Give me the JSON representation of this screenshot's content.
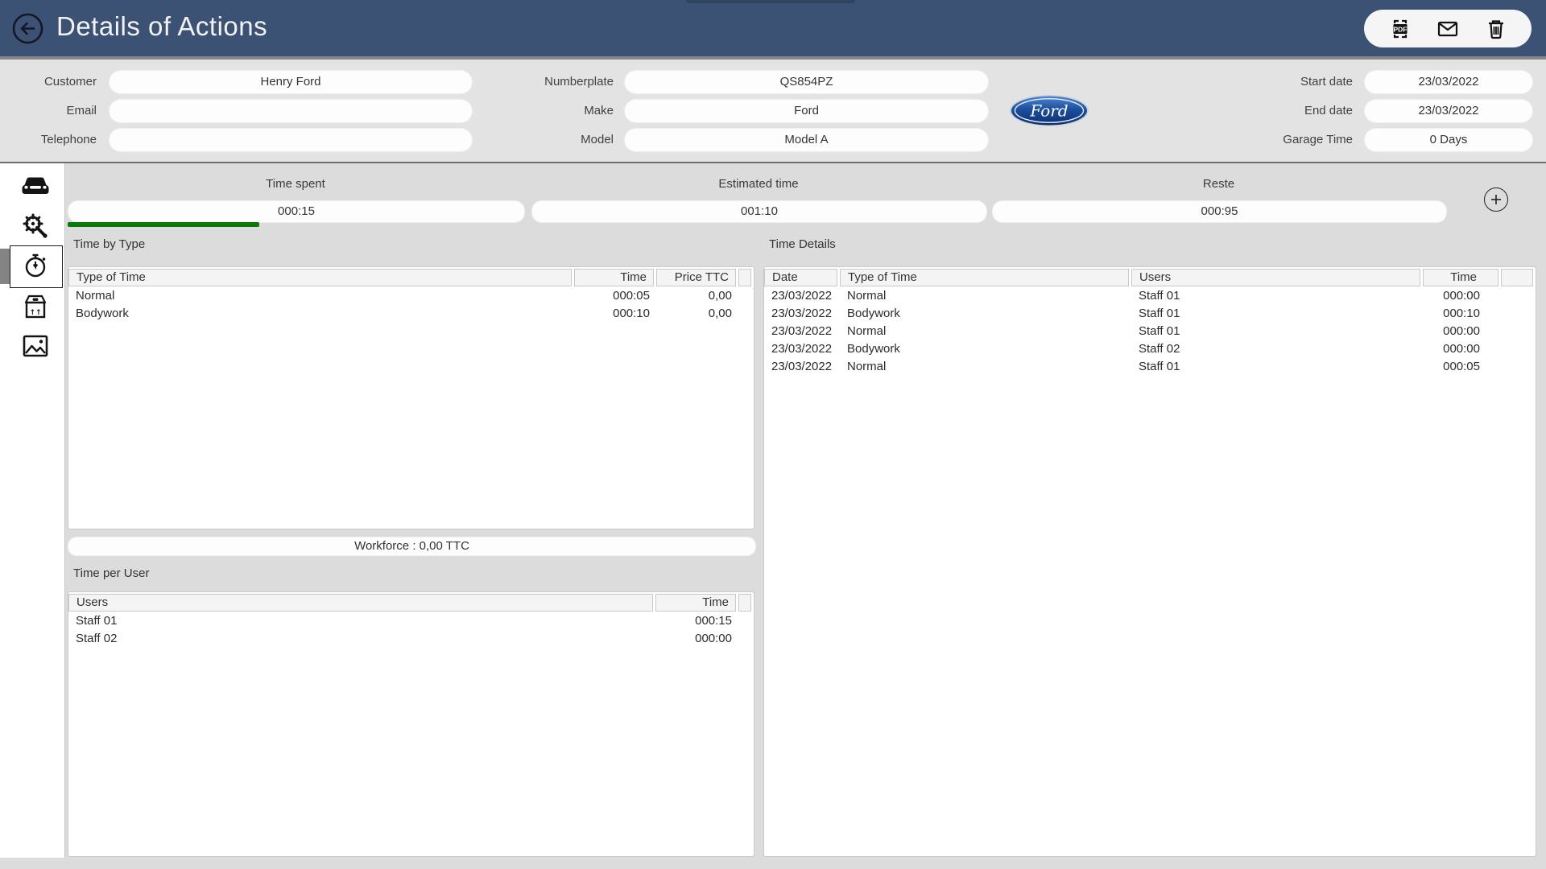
{
  "header": {
    "title": "Details of Actions",
    "toolbar_icons": [
      "pdf",
      "email",
      "delete"
    ]
  },
  "colors": {
    "header_bg": "#3b5275",
    "progress_green": "#0a7a0a",
    "ford_blue": "#1b4fa0"
  },
  "form": {
    "fields": [
      {
        "label": "Customer",
        "value": "Henry Ford"
      },
      {
        "label": "Email",
        "value": ""
      },
      {
        "label": "Telephone",
        "value": ""
      },
      {
        "label": "Numberplate",
        "value": "QS854PZ"
      },
      {
        "label": "Make",
        "value": "Ford"
      },
      {
        "label": "Model",
        "value": "Model A"
      },
      {
        "label": "Start date",
        "value": "23/03/2022"
      },
      {
        "label": "End date",
        "value": "23/03/2022"
      },
      {
        "label": "Garage Time",
        "value": "0 Days"
      }
    ],
    "brand": "Ford"
  },
  "sidebar": {
    "items": [
      {
        "icon": "car-icon",
        "selected": false
      },
      {
        "icon": "service-icon",
        "selected": false
      },
      {
        "icon": "stopwatch-icon",
        "selected": true
      },
      {
        "icon": "parts-box-icon",
        "selected": false
      },
      {
        "icon": "photos-icon",
        "selected": false
      }
    ]
  },
  "gauges": [
    {
      "label": "Time spent",
      "value": "000:15",
      "progress_pct": 42
    },
    {
      "label": "Estimated time",
      "value": "001:10"
    },
    {
      "label": "Reste",
      "value": "000:95"
    }
  ],
  "time_by_type": {
    "title": "Time by Type",
    "columns": [
      "Type of Time",
      "Time",
      "Price TTC"
    ],
    "rows": [
      [
        "Normal",
        "000:05",
        "0,00"
      ],
      [
        "Bodywork",
        "000:10",
        "0,00"
      ]
    ]
  },
  "workforce_summary": "Workforce : 0,00 TTC",
  "time_per_user": {
    "title": "Time per User",
    "columns": [
      "Users",
      "Time"
    ],
    "rows": [
      [
        "Staff 01",
        "000:15"
      ],
      [
        "Staff 02",
        "000:00"
      ]
    ]
  },
  "time_details": {
    "title": "Time Details",
    "columns": [
      "Date",
      "Type of Time",
      "Users",
      "Time"
    ],
    "rows": [
      [
        "23/03/2022",
        "Normal",
        "Staff 01",
        "000:00"
      ],
      [
        "23/03/2022",
        "Bodywork",
        "Staff 01",
        "000:10"
      ],
      [
        "23/03/2022",
        "Normal",
        "Staff 01",
        "000:00"
      ],
      [
        "23/03/2022",
        "Bodywork",
        "Staff 02",
        "000:00"
      ],
      [
        "23/03/2022",
        "Normal",
        "Staff 01",
        "000:05"
      ]
    ]
  }
}
